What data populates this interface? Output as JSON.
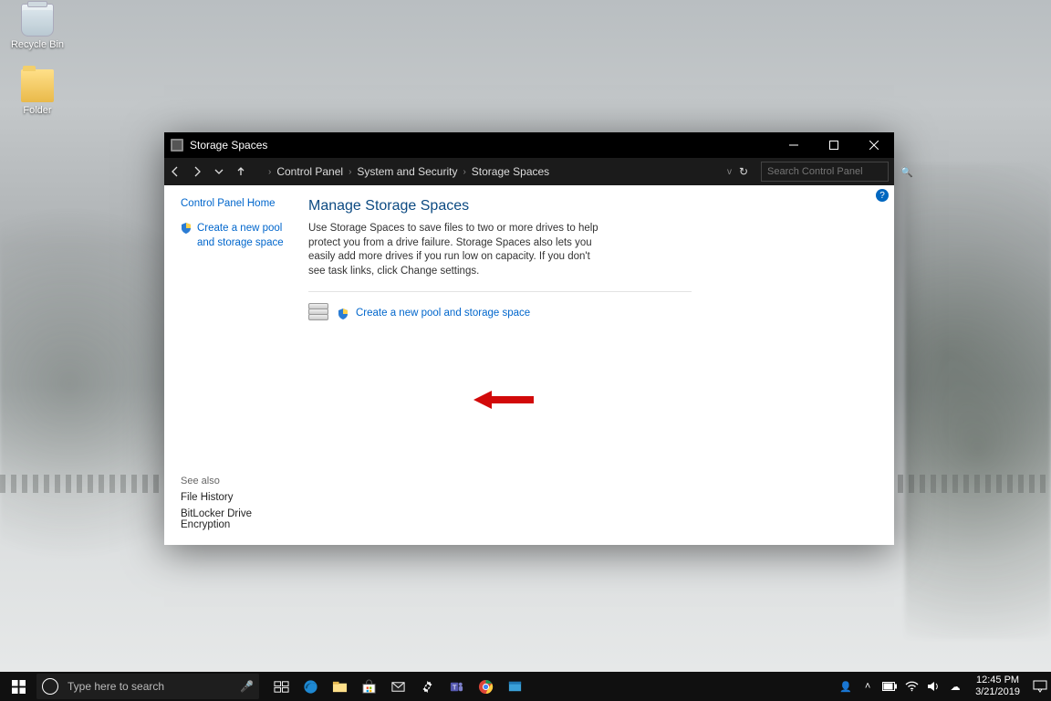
{
  "desktop": {
    "icons": {
      "recycle": "Recycle Bin",
      "folder": "Folder"
    }
  },
  "window": {
    "title": "Storage Spaces",
    "breadcrumbs": [
      "Control Panel",
      "System and Security",
      "Storage Spaces"
    ],
    "search_placeholder": "Search Control Panel",
    "sidebar": {
      "home": "Control Panel Home",
      "create_link": "Create a new pool and storage space",
      "see_also_header": "See also",
      "see_also": [
        "File History",
        "BitLocker Drive Encryption"
      ]
    },
    "main": {
      "heading": "Manage Storage Spaces",
      "description": "Use Storage Spaces to save files to two or more drives to help protect you from a drive failure. Storage Spaces also lets you easily add more drives if you run low on capacity. If you don't see task links, click Change settings.",
      "create_link": "Create a new pool and storage space"
    }
  },
  "taskbar": {
    "search_placeholder": "Type here to search",
    "clock": {
      "time": "12:45 PM",
      "date": "3/21/2019"
    }
  },
  "annotation": {
    "arrow_color": "#d20a0a"
  }
}
